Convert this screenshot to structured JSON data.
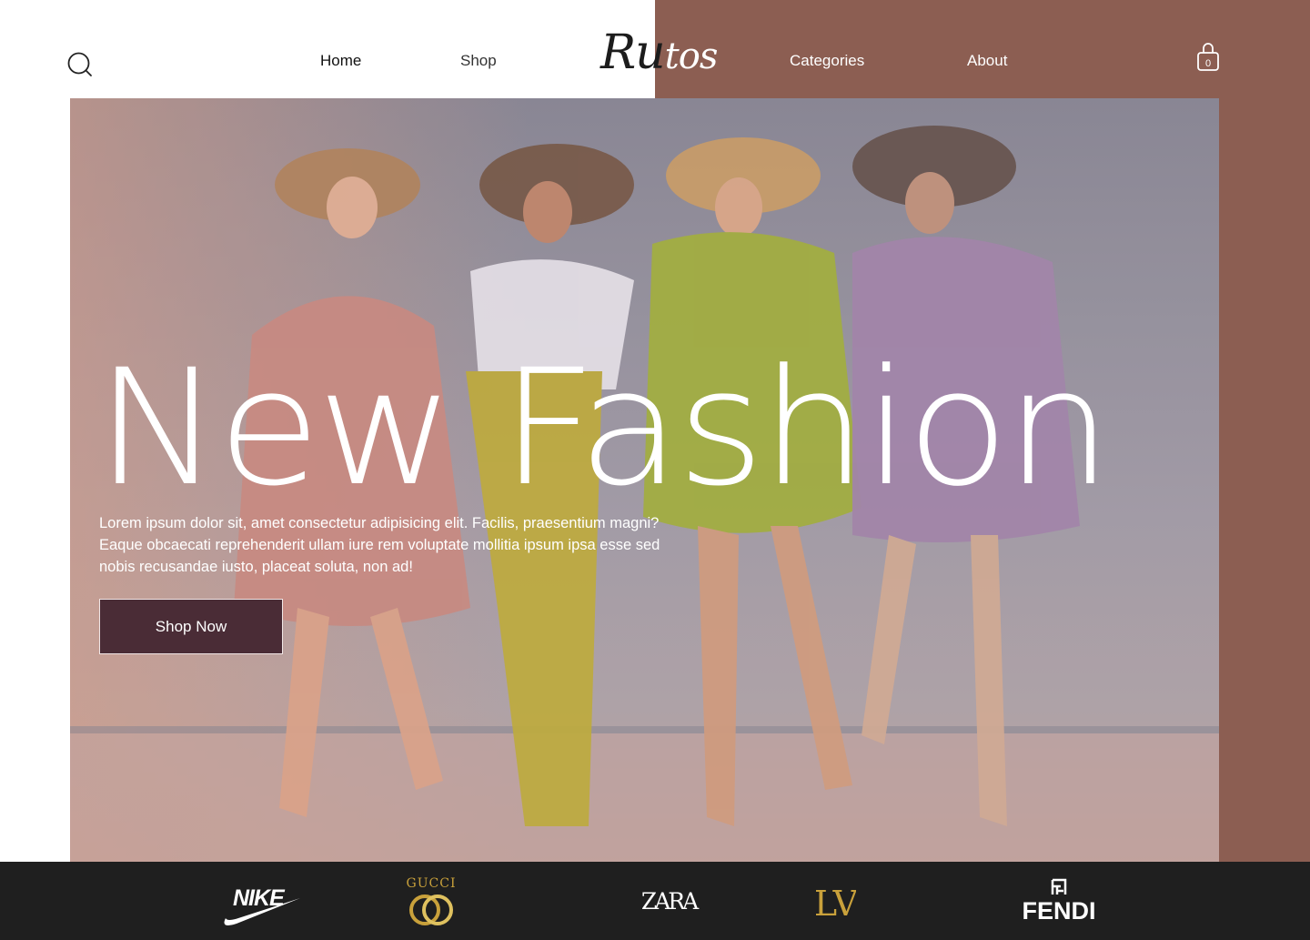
{
  "header": {
    "logo_part1": "Ru",
    "logo_part2": "tos",
    "nav": {
      "home": "Home",
      "shop": "Shop",
      "categories": "Categories",
      "about": "About"
    },
    "cart_count": "0"
  },
  "hero": {
    "title": "New Fashion",
    "description": "Lorem ipsum dolor sit, amet consectetur adipisicing elit. Facilis, praesentium magni? Eaque obcaecati reprehenderit ullam iure rem voluptate mollitia ipsum ipsa esse sed nobis recusandae iusto, placeat soluta, non ad!",
    "button_label": "Shop Now"
  },
  "brands": {
    "nike": "NIKE",
    "gucci": "GUCCI",
    "zara": "ZARA",
    "lv": "LV",
    "fendi": "FENDI"
  },
  "colors": {
    "accent_brown": "#8c5e52",
    "button_bg": "#4a2c36",
    "brand_bar": "#1f1f1f",
    "gold": "#c9a13b"
  }
}
